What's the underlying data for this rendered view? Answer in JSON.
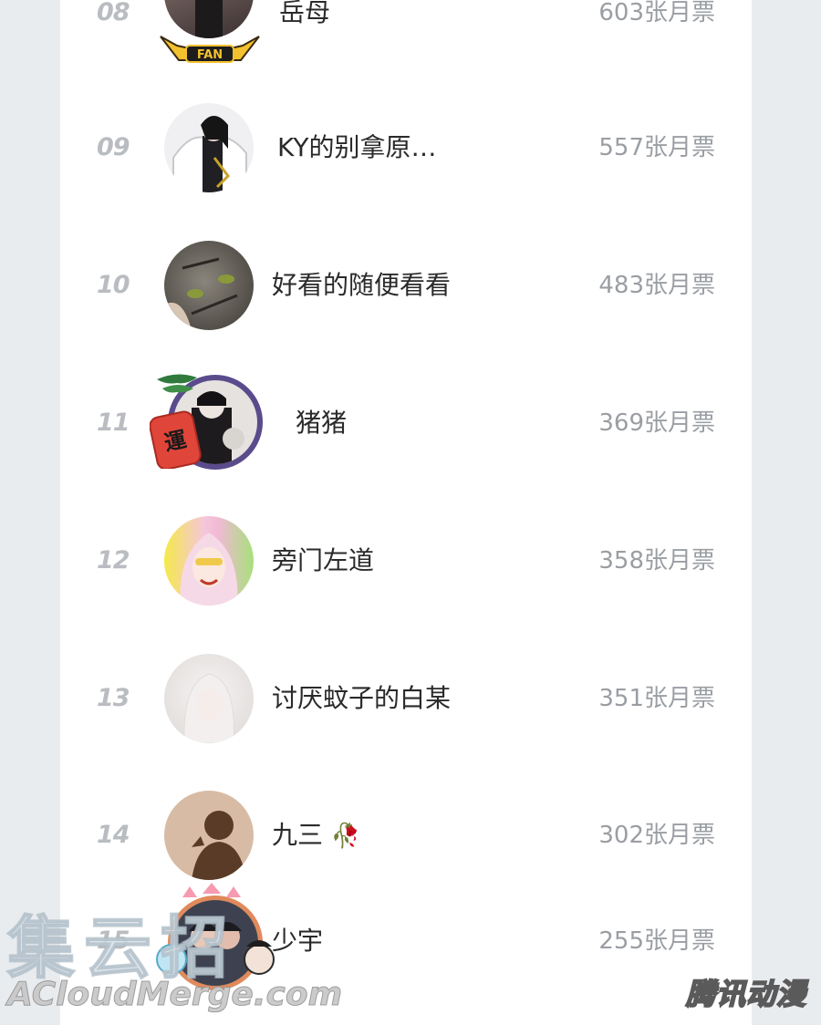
{
  "ranking": {
    "rows": [
      {
        "rank": "08",
        "name": "岳母",
        "votes": "603张月票",
        "avatar_color": "#6f5a55"
      },
      {
        "rank": "09",
        "name": "KY的别拿原…",
        "votes": "557张月票",
        "avatar_color": "#e8e8ec"
      },
      {
        "rank": "10",
        "name": "好看的随便看看",
        "votes": "483张月票",
        "avatar_color": "#6e6a63"
      },
      {
        "rank": "11",
        "name": "猪猪",
        "votes": "369张月票",
        "avatar_color": "#d9d4cf"
      },
      {
        "rank": "12",
        "name": "旁门左道",
        "votes": "358张月票",
        "avatar_color": "#f2d9e8"
      },
      {
        "rank": "13",
        "name": "讨厌蚊子的白某",
        "votes": "351张月票",
        "avatar_color": "#eceae9"
      },
      {
        "rank": "14",
        "name": "九三",
        "votes": "302张月票",
        "avatar_color": "#cfae95"
      },
      {
        "rank": "15",
        "name": "少宇",
        "votes": "255张月票",
        "avatar_color": "#4a4e5a"
      }
    ]
  },
  "badges": {
    "fan_label": "FAN",
    "luck_char": "運"
  },
  "watermark": {
    "left_cn": "集云招",
    "left_en": "ACloudMerge.com",
    "right": "腾讯动漫"
  },
  "colors": {
    "page_bg": "#e9ecef",
    "panel_bg": "#ffffff",
    "rank_gray": "#b9bcc0",
    "votes_gray": "#9a9ea3"
  }
}
